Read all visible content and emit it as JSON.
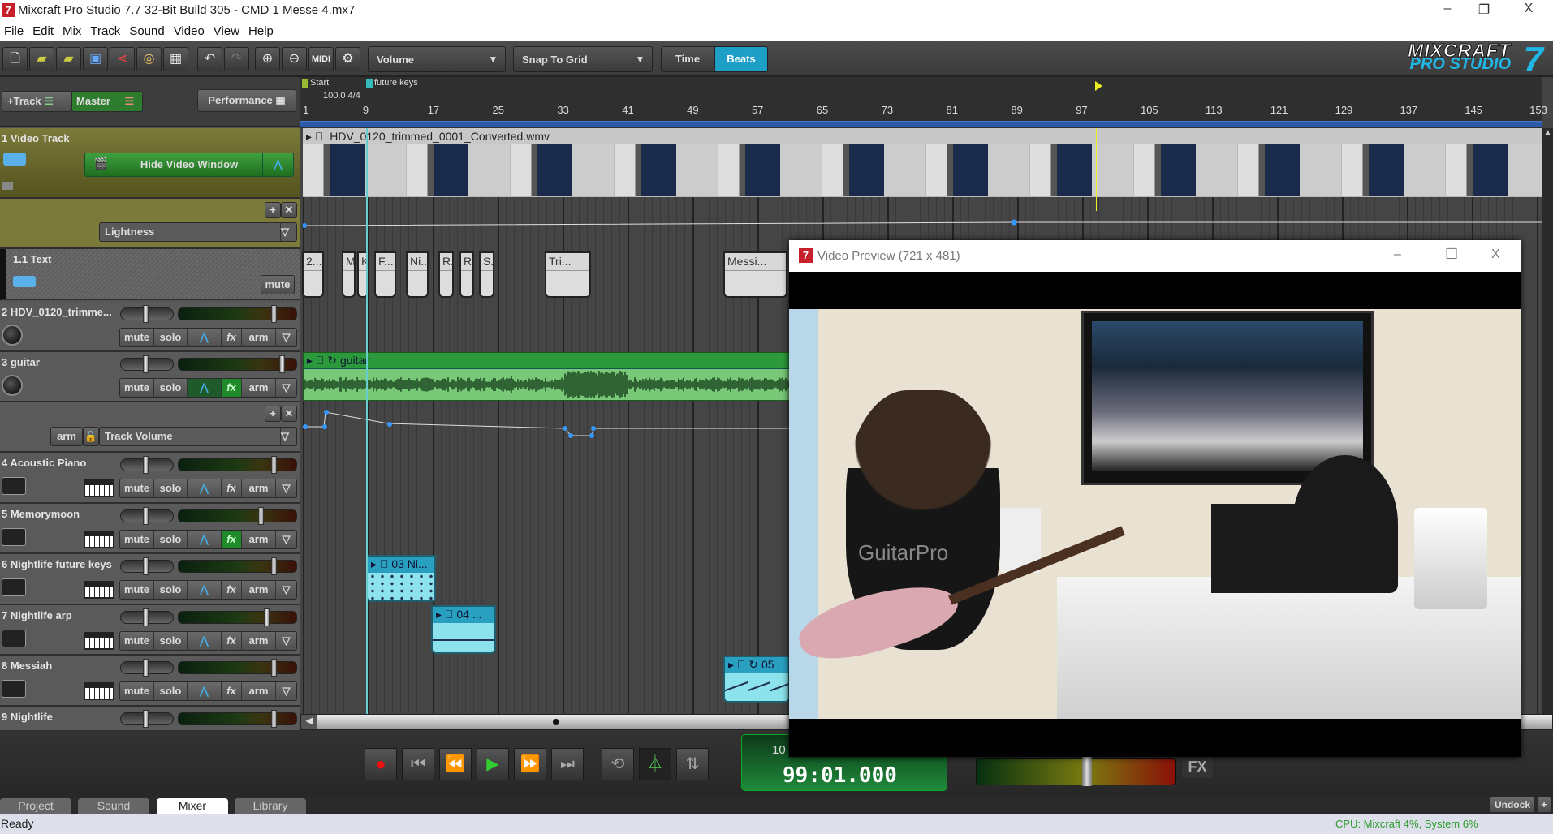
{
  "window": {
    "title": "Mixcraft Pro Studio 7.7 32-Bit Build 305 - CMD 1 Messe 4.mx7",
    "app_icon": "7",
    "minimize": "–",
    "restore": "❐",
    "close": "X"
  },
  "menu": [
    "File",
    "Edit",
    "Mix",
    "Track",
    "Sound",
    "Video",
    "View",
    "Help"
  ],
  "toolbar": {
    "icons": [
      "new-file",
      "open-folder",
      "open-recent",
      "save",
      "share",
      "burn-cd",
      "mixdown",
      "undo",
      "redo",
      "zoom-in",
      "zoom-out",
      "midi",
      "settings"
    ],
    "volume_select": "Volume",
    "snap_select": "Snap To Grid",
    "time_label": "Time",
    "beats_label": "Beats",
    "active_mode": "Beats"
  },
  "logo": {
    "line1": "MIXCRAFT",
    "line2": "PRO STUDIO",
    "version": "7"
  },
  "panel": {
    "add_track": "+Track",
    "master": "Master",
    "performance": "Performance"
  },
  "ruler": {
    "markers": [
      {
        "label": "Start"
      },
      {
        "label": "future keys"
      }
    ],
    "tempo": "100.0 4/4",
    "ticks": [
      "1",
      "9",
      "17",
      "25",
      "33",
      "41",
      "49",
      "57",
      "65",
      "73",
      "81",
      "89",
      "97",
      "105",
      "113",
      "121",
      "129",
      "137",
      "145",
      "153"
    ],
    "playhead_bar": 98
  },
  "tracks": {
    "video": {
      "name": "1 Video Track",
      "hide_button": "Hide Video Window",
      "clip": "HDV_0120_trimmed_0001_Converted.wmv",
      "automation": "Lightness"
    },
    "text": {
      "name": "1.1 Text",
      "mute": "mute",
      "clips": [
        "2...",
        "M.",
        "K",
        "F...",
        "Ni...",
        "R.",
        "R.",
        "S.",
        "Tri...",
        "Messi..."
      ]
    },
    "audio": [
      {
        "name": "2 HDV_0120_trimme...",
        "pan": 0.5,
        "volume": 0.83,
        "fx_active": false,
        "auto_active": false
      },
      {
        "name": "3 guitar",
        "pan": 0.5,
        "volume": 0.9,
        "fx_active": true,
        "auto_active": true,
        "clip": "guitar"
      }
    ],
    "guitar_automation": {
      "arm": "arm",
      "param": "Track Volume"
    },
    "instruments": [
      {
        "name": "4 Acoustic Piano",
        "pan": 0.5,
        "volume": 0.83,
        "fx_active": false
      },
      {
        "name": "5 Memorymoon",
        "pan": 0.5,
        "volume": 0.72,
        "fx_active": true
      },
      {
        "name": "6 Nightlife future keys",
        "pan": 0.5,
        "volume": 0.83,
        "fx_active": false,
        "clip": "03 Ni..."
      },
      {
        "name": "7 Nightlife arp",
        "pan": 0.5,
        "volume": 0.77,
        "fx_active": false,
        "clip": "04 ..."
      },
      {
        "name": "8 Messiah",
        "pan": 0.5,
        "volume": 0.83,
        "fx_active": false,
        "clip": "05"
      },
      {
        "name": "9 Nightlife",
        "pan": 0.5,
        "volume": 0.83,
        "fx_active": false
      }
    ],
    "labels": {
      "mute": "mute",
      "solo": "solo",
      "fx": "fx",
      "arm": "arm"
    }
  },
  "video_preview": {
    "title": "Video Preview (721 x 481)",
    "icon": "7",
    "minimize": "–",
    "maximize": "☐",
    "close": "X",
    "watermark": "GuitarPro"
  },
  "transport": {
    "time": "99:01.000",
    "tempo_partial": "10",
    "fx": "FX",
    "master_volume": 0.55
  },
  "tabs": [
    "Project",
    "Sound",
    "Mixer",
    "Library"
  ],
  "active_tab": "Mixer",
  "undock": "Undock",
  "status": {
    "left": "Ready",
    "cpu": "CPU: Mixcraft 4%, System 6%"
  }
}
